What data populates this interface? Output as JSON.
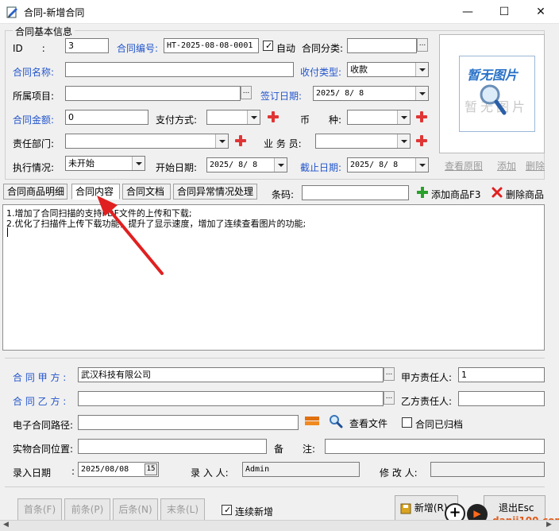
{
  "window": {
    "title": "合同-新增合同"
  },
  "basic_info": {
    "section_title": "合同基本信息",
    "id_label": "ID　　:",
    "id_value": "3",
    "contract_no_label": "合同编号:",
    "contract_no_value": "HT-2025-08-08-0001",
    "auto_label": "自动",
    "category_label": "合同分类:",
    "category_value": "",
    "name_label": "合同名称:",
    "name_value": "",
    "payment_type_label": "收付类型:",
    "payment_type_value": "收款",
    "project_label": "所属项目:",
    "project_value": "",
    "sign_date_label": "签订日期:",
    "sign_date_value": "2025/ 8/ 8",
    "amount_label": "合同金额:",
    "amount_value": "0",
    "pay_method_label": "支付方式:",
    "pay_method_value": "",
    "currency_label": "币　　种:",
    "currency_value": "",
    "dept_label": "责任部门:",
    "dept_value": "",
    "staff_label": "业 务 员:",
    "staff_value": "",
    "status_label": "执行情况:",
    "status_value": "未开始",
    "start_date_label": "开始日期:",
    "start_date_value": "2025/ 8/ 8",
    "end_date_label": "截止日期:",
    "end_date_value": "2025/ 8/ 8"
  },
  "photo": {
    "placeholder_top": "暂无图片",
    "placeholder_bottom": "暂无图片",
    "view_label": "查看原图",
    "add_label": "添加",
    "delete_label": "删除"
  },
  "tabs": [
    {
      "label": "合同商品明细"
    },
    {
      "label": "合同内容"
    },
    {
      "label": "合同文档"
    },
    {
      "label": "合同异常情况处理"
    }
  ],
  "toolbar": {
    "barcode_label": "条码:",
    "barcode_value": "",
    "add_product_label": "添加商品F3",
    "delete_product_label": "删除商品"
  },
  "content": {
    "lines": [
      "1.增加了合同扫描的支持PDF文件的上传和下载;",
      "2.优化了扫描件上传下载功能，提升了显示速度，增加了连续查看图片的功能;"
    ]
  },
  "parties": {
    "party_a_label": "合 同 甲 方 :",
    "party_a_value": "武汉科技有限公司",
    "party_a_person_label": "甲方责任人:",
    "party_a_person_value": "1",
    "party_b_label": "合 同 乙 方 :",
    "party_b_value": "",
    "party_b_person_label": "乙方责任人:",
    "party_b_person_value": ""
  },
  "files": {
    "e_path_label": "电子合同路径:",
    "e_path_value": "",
    "view_file_label": "查看文件",
    "archived_label": "合同已归档",
    "physical_label": "实物合同位置:",
    "physical_value": "",
    "remark_label": "备　　注:",
    "remark_value": ""
  },
  "entry": {
    "entry_date_label": "录入日期",
    "entry_date_value": "2025/08/08",
    "calendar_label": "15",
    "entry_person_label": "录 入 人:",
    "entry_person_value": "Admin",
    "modifier_label": "修 改 人:",
    "modifier_value": ""
  },
  "footer": {
    "first_label": "首条(F)",
    "prev_label": "前条(P)",
    "next_label": "后条(N)",
    "last_label": "末条(L)",
    "continuous_label": "连续新增",
    "new_label": "新增(R)",
    "exit_label": "退出Esc"
  },
  "watermark": {
    "text": "danji100.com"
  },
  "colors": {
    "label_blue": "#2255cc",
    "plus_red": "#e03535",
    "arrow_red": "#e02020"
  }
}
